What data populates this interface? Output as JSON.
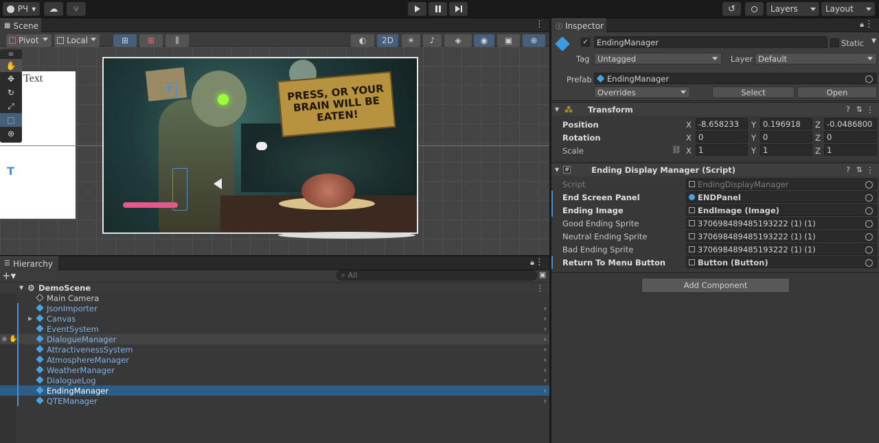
{
  "topbar": {
    "account_label": "РЧ",
    "layers_label": "Layers",
    "layout_label": "Layout"
  },
  "scene": {
    "tab_label": "Scene",
    "pivot_label": "Pivot",
    "local_label": "Local",
    "mode_2d_label": "2D",
    "text_object_label": "Text",
    "sign_text": "PRESS, OR YOUR BRAIN WILL BE EATEN!"
  },
  "hierarchy": {
    "tab_label": "Hierarchy",
    "search_placeholder": "All",
    "scene_name": "DemoScene",
    "items": [
      {
        "name": "Main Camera",
        "state": "normal"
      },
      {
        "name": "JsonImporter",
        "state": "prefab"
      },
      {
        "name": "Canvas",
        "state": "prefab"
      },
      {
        "name": "EventSystem",
        "state": "prefab"
      },
      {
        "name": "DialogueManager",
        "state": "prefab"
      },
      {
        "name": "AttractivenessSystem",
        "state": "prefab"
      },
      {
        "name": "AtmosphereManager",
        "state": "prefab"
      },
      {
        "name": "WeatherManager",
        "state": "prefab"
      },
      {
        "name": "DialogueLog",
        "state": "prefab"
      },
      {
        "name": "EndingManager",
        "state": "selected"
      },
      {
        "name": "QTEManager",
        "state": "prefab"
      }
    ]
  },
  "inspector": {
    "tab_label": "Inspector",
    "object_name": "EndingManager",
    "static_label": "Static",
    "tag_label": "Tag",
    "tag_value": "Untagged",
    "layer_label": "Layer",
    "layer_value": "Default",
    "prefab_label": "Prefab",
    "prefab_value": "EndingManager",
    "overrides_label": "Overrides",
    "select_label": "Select",
    "open_label": "Open",
    "transform": {
      "title": "Transform",
      "position_label": "Position",
      "rotation_label": "Rotation",
      "scale_label": "Scale",
      "axis_x": "X",
      "axis_y": "Y",
      "axis_z": "Z",
      "position": [
        "-8.658233",
        "0.196918",
        "-0.0486800"
      ],
      "rotation": [
        "0",
        "0",
        "0"
      ],
      "scale": [
        "1",
        "1",
        "1"
      ]
    },
    "script_component": {
      "title": "Ending Display Manager (Script)",
      "fields": [
        {
          "label": "Script",
          "value": "EndingDisplayManager",
          "style": "dim"
        },
        {
          "label": "End Screen Panel",
          "value": "ENDPanel",
          "style": "bold"
        },
        {
          "label": "Ending Image",
          "value": "EndImage (Image)",
          "style": "bold"
        },
        {
          "label": "Good Ending Sprite",
          "value": "370698489485193222 (1) (1)",
          "style": "normal"
        },
        {
          "label": "Neutral Ending Sprite",
          "value": "370698489485193222 (1) (1)",
          "style": "normal"
        },
        {
          "label": "Bad Ending Sprite",
          "value": "370698489485193222 (1) (1)",
          "style": "normal"
        },
        {
          "label": "Return To Menu Button",
          "value": "Button (Button)",
          "style": "bold"
        }
      ]
    },
    "add_component_label": "Add Component"
  },
  "colors": {
    "selection": "#2c5d87",
    "prefab_text": "#7fb4e8",
    "accent": "#46607c"
  }
}
